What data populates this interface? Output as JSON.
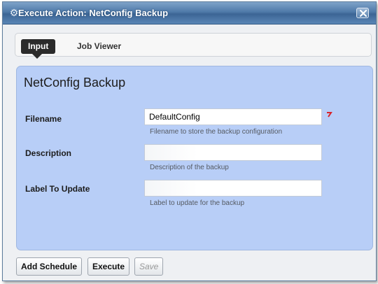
{
  "window": {
    "title": "Execute Action: NetConfig Backup",
    "title_icon": "gear-icon",
    "close_icon": "close-icon"
  },
  "tabs": [
    {
      "label": "Input",
      "selected": true
    },
    {
      "label": "Job Viewer",
      "selected": false
    }
  ],
  "form": {
    "title": "NetConfig Backup",
    "fields": [
      {
        "label": "Filename",
        "value": "DefaultConfig",
        "hint": "Filename to store the backup configuration",
        "required": true
      },
      {
        "label": "Description",
        "value": "",
        "hint": "Description of the backup",
        "required": false
      },
      {
        "label": "Label To Update",
        "value": "",
        "hint": "Label to update for the backup",
        "required": false
      }
    ]
  },
  "buttons": {
    "add_schedule": "Add Schedule",
    "execute": "Execute",
    "save": "Save"
  },
  "colors": {
    "titlebar": "#4f7aa9",
    "panel": "#b8cef7",
    "required": "#d8232a"
  }
}
